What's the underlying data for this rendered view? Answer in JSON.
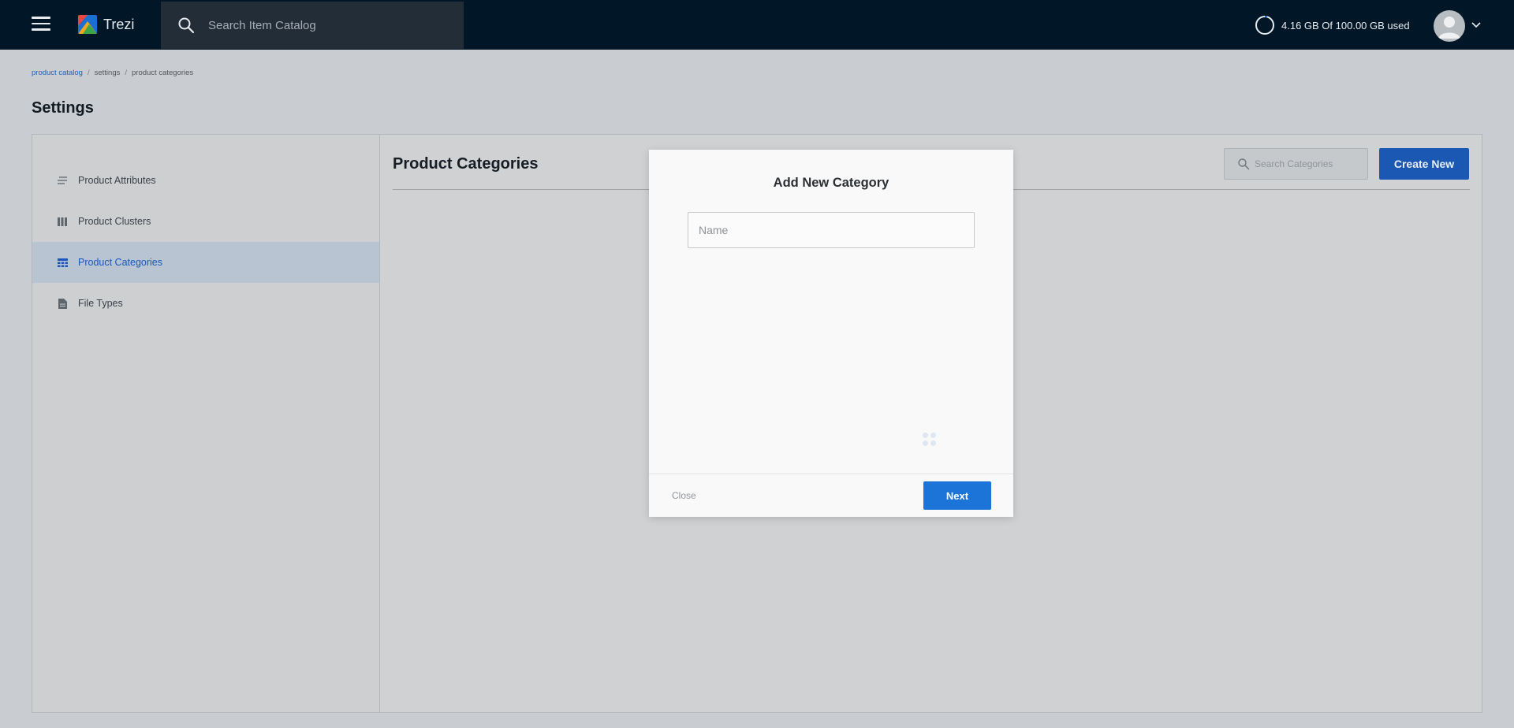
{
  "header": {
    "app_name": "Trezi",
    "search_placeholder": "Search Item Catalog",
    "storage_text": "4.16 GB Of 100.00 GB used",
    "storage_used_fraction": 0.0416
  },
  "breadcrumb": {
    "items": [
      "product catalog",
      "settings",
      "product categories"
    ],
    "separator": "/"
  },
  "page_title": "Settings",
  "sidebar": {
    "items": [
      {
        "label": "Product Attributes",
        "icon": "list-lines-icon",
        "active": false
      },
      {
        "label": "Product Clusters",
        "icon": "columns-icon",
        "active": false
      },
      {
        "label": "Product Categories",
        "icon": "table-grid-icon",
        "active": true
      },
      {
        "label": "File Types",
        "icon": "document-icon",
        "active": false
      }
    ]
  },
  "content": {
    "title": "Product Categories",
    "search_placeholder": "Search Categories",
    "create_label": "Create New"
  },
  "modal": {
    "title": "Add New Category",
    "name_placeholder": "Name",
    "close_label": "Close",
    "next_label": "Next"
  },
  "colors": {
    "topbar": "#011627",
    "primary": "#1c74d9",
    "active_text": "#1a57b8"
  }
}
